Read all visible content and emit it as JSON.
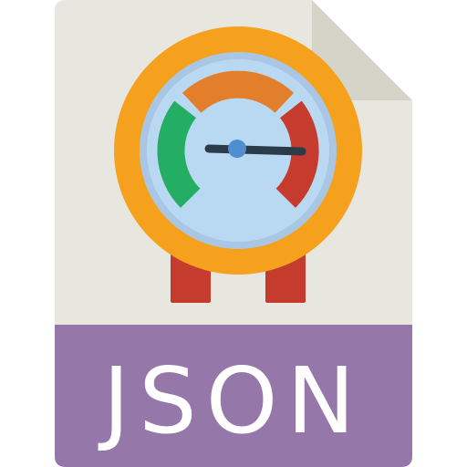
{
  "file_type": {
    "label": "JSON",
    "icon": "gauge-icon"
  },
  "colors": {
    "page": "#e8e7df",
    "page_fold": "#d5d4c8",
    "banner": "#9577a9",
    "label_text": "#ffffff",
    "gauge_ring": "#f5a11e",
    "gauge_bezel": "#a9c7e4",
    "gauge_face": "#b9d9f2",
    "arc_low": "#23ae63",
    "arc_mid": "#e37f2b",
    "arc_high": "#c53b2e",
    "legs": "#c53b2e",
    "needle": "#2c3b4a",
    "needle_hub": "#4f8ed1"
  }
}
